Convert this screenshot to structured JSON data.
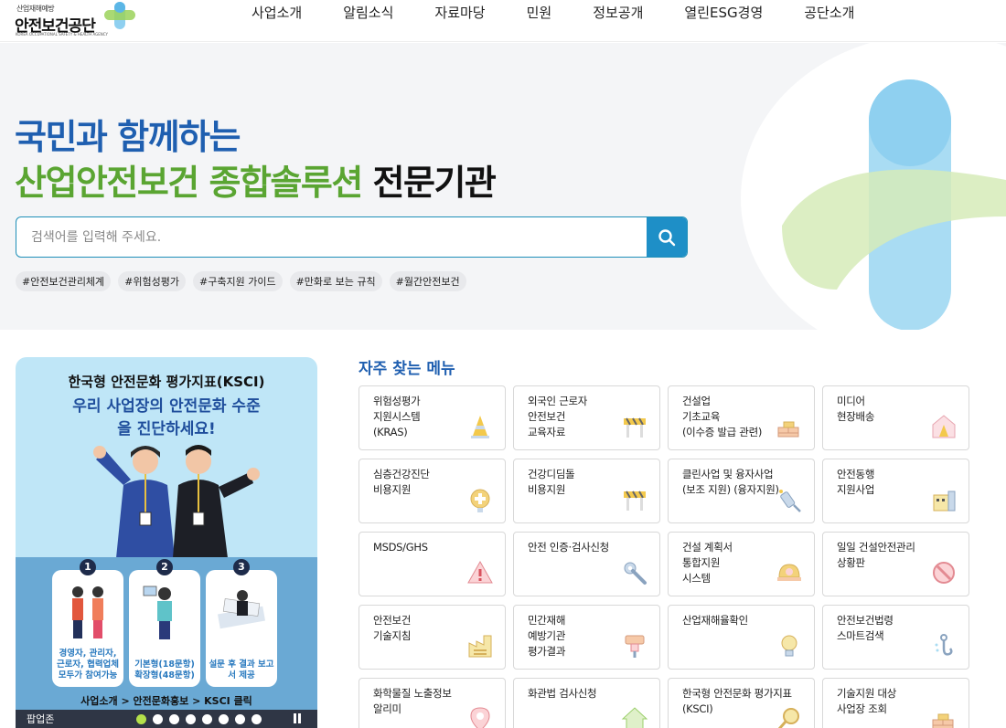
{
  "header": {
    "logo_sub": "산업재해예방",
    "logo_main": "안전보건공단",
    "logo_eng": "KOREA OCCUPATIONAL SAFETY & HEALTH AGENCY",
    "nav": [
      "사업소개",
      "알림소식",
      "자료마당",
      "민원",
      "정보공개",
      "열린ESG경영",
      "공단소개"
    ]
  },
  "hero": {
    "line1": "국민과 함께하는",
    "line2_green": "산업안전보건 종합솔루션",
    "line2_dark": "전문기관",
    "search_placeholder": "검색어를 입력해 주세요.",
    "tags": [
      "#안전보건관리체계",
      "#위험성평가",
      "#구축지원 가이드",
      "#만화로 보는 규칙",
      "#월간안전보건"
    ]
  },
  "banner": {
    "title": "한국형 안전문화 평가지표(KSCI)",
    "headline": "우리 사업장의 안전문화 수준을 진단하세요!",
    "steps": [
      {
        "num": "1",
        "caption": "경영자, 관리자, 근로자, 협력업체 모두가 참여가능"
      },
      {
        "num": "2",
        "caption": "기본형(18문항) 확장형(48문항)"
      },
      {
        "num": "3",
        "caption": "설문 후 결과 보고서 제공"
      }
    ],
    "path": "사업소개 > 안전문화홍보 > KSCI 클릭",
    "bar_label": "팝업존",
    "dot_count": 8
  },
  "quick_menu": {
    "title": "자주 찾는 메뉴",
    "items": [
      {
        "label": "위험성평가\n지원시스템\n(KRAS)",
        "icon": "cone-icon"
      },
      {
        "label": "외국인 근로자\n안전보건\n교육자료",
        "icon": "barrier-icon"
      },
      {
        "label": "건설업\n기초교육\n(이수증 발급 관련)",
        "icon": "bricks-icon"
      },
      {
        "label": "미디어\n현장배송",
        "icon": "house-cone-icon"
      },
      {
        "label": "심층건강진단\n비용지원",
        "icon": "medical-badge-icon"
      },
      {
        "label": "건강디딤돌\n비용지원",
        "icon": "barrier-icon"
      },
      {
        "label": "클린사업 및 융자사업\n(보조 지원) (융자지원)",
        "icon": "sprayer-icon"
      },
      {
        "label": "안전동행\n지원사업",
        "icon": "building-icon"
      },
      {
        "label": "MSDS/GHS",
        "icon": "warning-icon"
      },
      {
        "label": "안전 인증·검사신청",
        "icon": "wrench-icon"
      },
      {
        "label": "건설 계획서\n통합지원\n시스템",
        "icon": "helmet-icon"
      },
      {
        "label": "일일 건설안전관리\n상황판",
        "icon": "prohibit-icon"
      },
      {
        "label": "안전보건\n기술지침",
        "icon": "factory-icon"
      },
      {
        "label": "민간재해\n예방기관\n평가결과",
        "icon": "drill-icon"
      },
      {
        "label": "산업재해율확인",
        "icon": "bulb-icon"
      },
      {
        "label": "안전보건법령\n스마트검색",
        "icon": "hook-icon"
      },
      {
        "label": "화학물질 노출정보\n알리미",
        "icon": "location-icon"
      },
      {
        "label": "화관법 검사신청",
        "icon": "home-icon"
      },
      {
        "label": "한국형 안전문화 평가지표\n(KSCI)",
        "icon": "search-doc-icon"
      },
      {
        "label": "기술지원 대상\n사업장 조회",
        "icon": "bricks-icon"
      }
    ]
  }
}
